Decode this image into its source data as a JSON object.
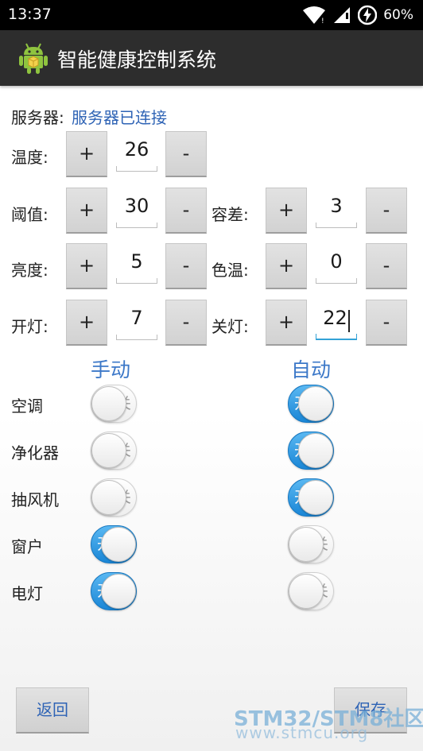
{
  "status_bar": {
    "time": "13:37",
    "battery_percent": "60%",
    "icons": [
      "wifi-icon",
      "signal-icon",
      "battery-charging-icon"
    ]
  },
  "action_bar": {
    "title": "智能健康控制系统",
    "icon": "android-app-icon"
  },
  "server": {
    "label": "服务器:",
    "status": "服务器已连接"
  },
  "controls": {
    "temperature": {
      "label": "温度:",
      "value": "26"
    },
    "threshold": {
      "label": "阈值:",
      "value": "30"
    },
    "tolerance": {
      "label": "容差:",
      "value": "3"
    },
    "brightness": {
      "label": "亮度:",
      "value": "5"
    },
    "color_temp": {
      "label": "色温:",
      "value": "0"
    },
    "light_on": {
      "label": "开灯:",
      "value": "7"
    },
    "light_off": {
      "label": "关灯:",
      "value": "22"
    },
    "plus_label": "+",
    "minus_label": "-"
  },
  "columns": {
    "manual": "手动",
    "auto": "自动"
  },
  "toggle_text": {
    "on": "开",
    "off": "关"
  },
  "devices": [
    {
      "label": "空调",
      "manual": false,
      "auto": true
    },
    {
      "label": "净化器",
      "manual": false,
      "auto": true
    },
    {
      "label": "抽风机",
      "manual": false,
      "auto": true
    },
    {
      "label": "窗户",
      "manual": true,
      "auto": false
    },
    {
      "label": "电灯",
      "manual": true,
      "auto": false
    }
  ],
  "footer": {
    "back_label": "返回",
    "save_label": "保存"
  },
  "watermark": {
    "line1": "STM32/STM8社区",
    "line2": "www.stmcu.org"
  },
  "colors": {
    "accent": "#3c78c8",
    "toggle_on": "#1a86d6",
    "action_bar": "#2d2d2d",
    "focus_underline": "#33a2d6"
  }
}
